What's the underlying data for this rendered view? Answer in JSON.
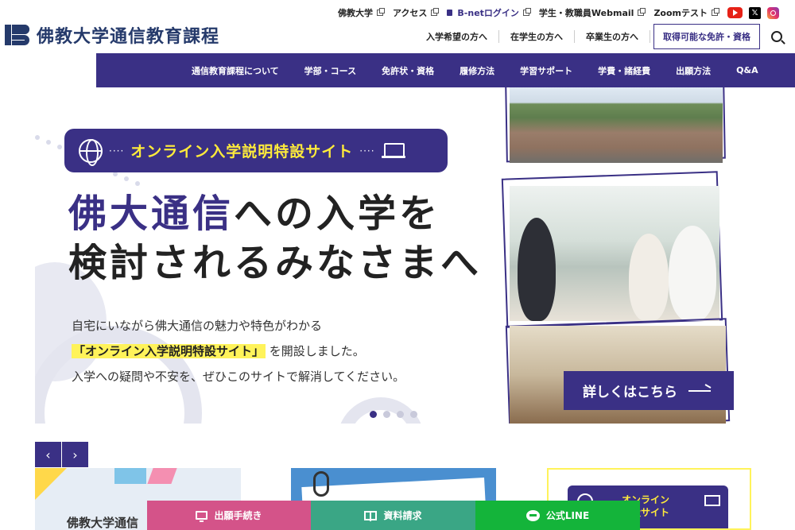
{
  "header": {
    "logo_text": "佛教大学通信教育課程",
    "utility": [
      {
        "label": "佛教大学"
      },
      {
        "label": "アクセス"
      },
      {
        "label": "B-netログイン"
      },
      {
        "label": "学生・教職員Webmail"
      },
      {
        "label": "Zoomテスト"
      }
    ],
    "secondary": [
      {
        "label": "入学希望の方へ"
      },
      {
        "label": "在学生の方へ"
      },
      {
        "label": "卒業生の方へ"
      }
    ],
    "license_button": "取得可能な免許・資格",
    "social_x": "𝕏"
  },
  "nav": {
    "items": [
      {
        "label": "通信教育課程について"
      },
      {
        "label": "学部・コース"
      },
      {
        "label": "免許状・資格"
      },
      {
        "label": "履修方法"
      },
      {
        "label": "学習サポート"
      },
      {
        "label": "学費・諸経費"
      },
      {
        "label": "出願方法"
      },
      {
        "label": "Q&A"
      }
    ]
  },
  "hero": {
    "banner_dots": "····",
    "banner_title": "オンライン入学説明特設サイト",
    "headline_accent": "佛大通信",
    "headline_rest1": "への入学を",
    "headline_line2": "検討されるみなさまへ",
    "desc_line1": "自宅にいながら佛大通信の魅力や特色がわかる",
    "desc_mark": "「オンライン入学説明特設サイト」",
    "desc_line2_rest": "を開設しました。",
    "desc_line3": "入学への疑問や不安を、ぜひこのサイトで解消してください。",
    "detail_button": "詳しくはこちら",
    "slide_count": 4,
    "active_slide": 1
  },
  "carousel": {
    "prev_label": "‹",
    "next_label": "›",
    "card1_text": "佛教大学通信",
    "card3_title_line1": "オンライン",
    "card3_title_line2": "特設サイト"
  },
  "bottombar": {
    "apply": "出願手続き",
    "docs": "資料請求",
    "line": "公式LINE"
  },
  "colors": {
    "brand": "#3a3085",
    "accent_yellow": "#ffeb3b",
    "apply": "#d45389",
    "docs": "#3aa685",
    "line": "#14b43a"
  }
}
